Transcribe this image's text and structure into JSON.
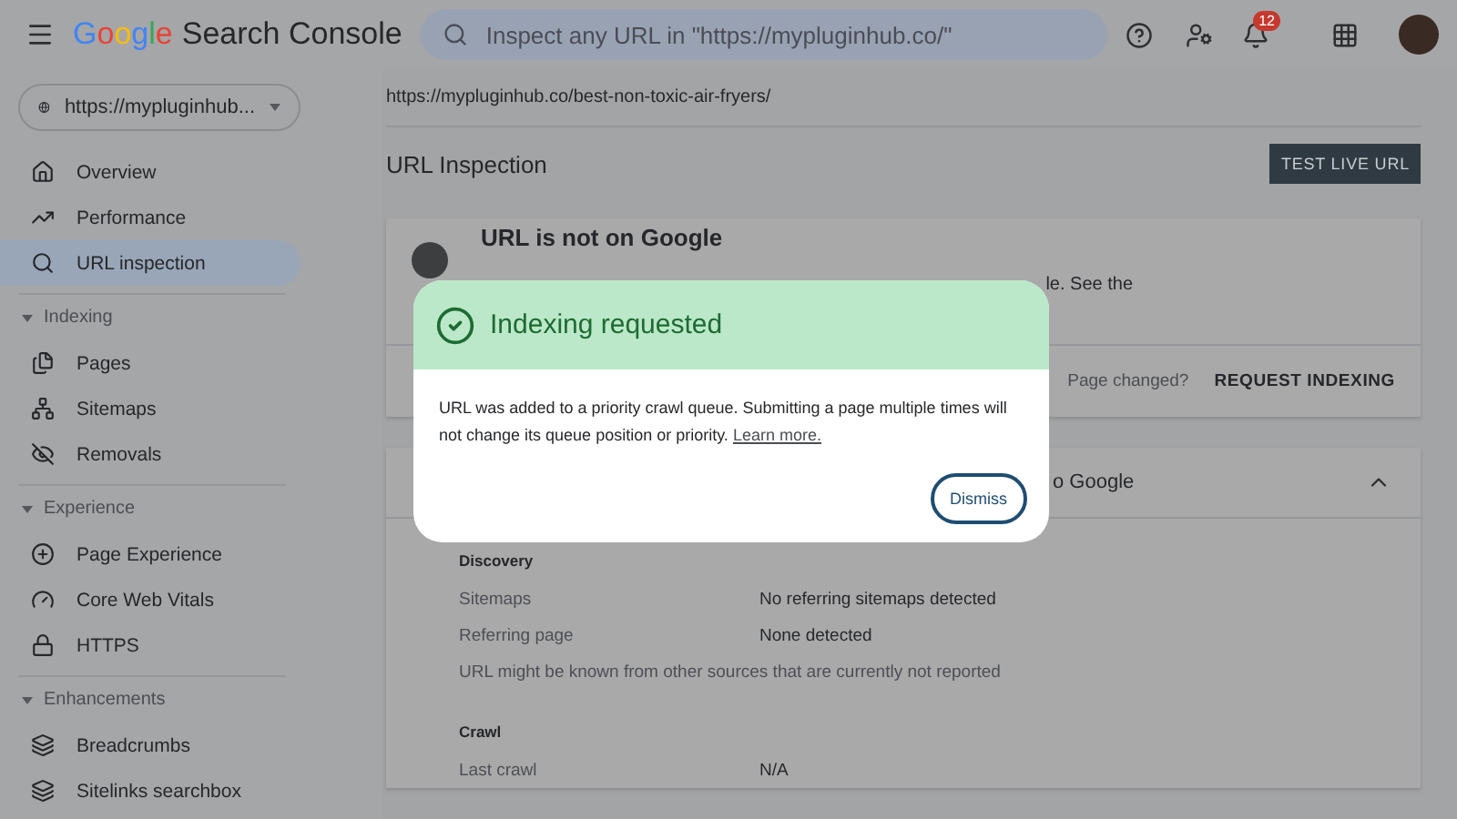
{
  "topbar": {
    "logo_word": "Google",
    "product": "Search Console",
    "search": {
      "placeholder": "Inspect any URL in \"https://mypluginhub.co/\""
    },
    "notifications_badge": "12"
  },
  "property": {
    "label": "https://mypluginhub..."
  },
  "sidebar": {
    "items": [
      {
        "kind": "home",
        "label": "Overview",
        "selected": false
      },
      {
        "kind": "trend",
        "label": "Performance",
        "selected": false
      },
      {
        "kind": "search",
        "label": "URL inspection",
        "selected": true
      }
    ],
    "sections": [
      {
        "label": "Indexing",
        "expanded": true,
        "items": [
          {
            "kind": "pages",
            "label": "Pages",
            "selected": false
          },
          {
            "kind": "sitemap",
            "label": "Sitemaps",
            "selected": false
          },
          {
            "kind": "removal",
            "label": "Removals",
            "selected": false
          }
        ]
      },
      {
        "label": "Experience",
        "expanded": true,
        "items": [
          {
            "kind": "plus",
            "label": "Page Experience",
            "selected": false
          },
          {
            "kind": "gauge",
            "label": "Core Web Vitals",
            "selected": false
          },
          {
            "kind": "lock",
            "label": "HTTPS",
            "selected": false
          }
        ]
      },
      {
        "label": "Enhancements",
        "expanded": true,
        "items": [
          {
            "kind": "layers",
            "label": "Breadcrumbs",
            "selected": false
          },
          {
            "kind": "layers2",
            "label": "Sitelinks searchbox",
            "selected": false
          }
        ]
      }
    ]
  },
  "main": {
    "url": "https://mypluginhub.co/best-non-toxic-air-fryers/",
    "title": "URL Inspection",
    "test_button": "TEST LIVE URL",
    "status_card": {
      "title": "URL is not on Google",
      "text_fragment": "le. See the",
      "prompt": "Page changed?",
      "action": "REQUEST INDEXING"
    },
    "details": {
      "header_fragment": "o Google",
      "expanded": true,
      "sections": [
        {
          "title": "Discovery",
          "rows": [
            {
              "kind": "pair",
              "label": "Sitemaps",
              "value": "No referring sitemaps detected"
            },
            {
              "kind": "pair",
              "label": "Referring page",
              "value": "None detected"
            },
            {
              "kind": "note",
              "label": "URL might be known from other sources that are currently not reported"
            }
          ]
        },
        {
          "title": "Crawl",
          "rows": [
            {
              "kind": "pair",
              "label": "Last crawl",
              "value": "N/A"
            }
          ]
        }
      ]
    }
  },
  "dialog": {
    "title": "Indexing requested",
    "message": "URL was added to a priority crawl queue. Submitting a page multiple times will not change its queue position or priority.",
    "link": "Learn more.",
    "button": "Dismiss"
  }
}
